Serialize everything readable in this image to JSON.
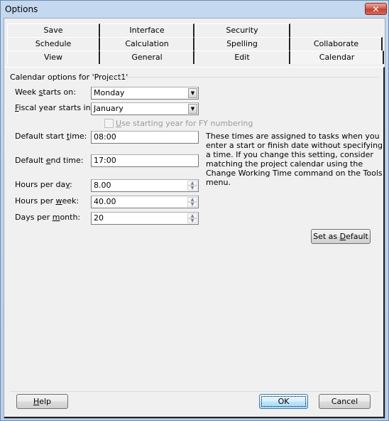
{
  "window": {
    "title": "Options",
    "close_icon": "close-x-icon"
  },
  "tabs": {
    "row1": [
      "Save",
      "Interface",
      "Security"
    ],
    "row2": [
      "Schedule",
      "Calculation",
      "Spelling",
      "Collaborate"
    ],
    "row3": [
      "View",
      "General",
      "Edit",
      "Calendar"
    ],
    "active": "Calendar"
  },
  "calendar": {
    "group_label": "Calendar options for 'Project1'",
    "week_starts_on": {
      "label_pre": "Week ",
      "label_u": "s",
      "label_post": "tarts on:",
      "value": "Monday"
    },
    "fiscal_year": {
      "label_pre": "",
      "label_u": "F",
      "label_post": "iscal year starts in:",
      "value": "January"
    },
    "fy_checkbox": {
      "label_pre": "",
      "label_u": "U",
      "label_post": "se starting year for FY numbering",
      "checked": false,
      "enabled": false
    },
    "default_start": {
      "label_pre": "Default start ",
      "label_u": "t",
      "label_post": "ime:",
      "value": "08:00"
    },
    "default_end": {
      "label_pre": "Default ",
      "label_u": "e",
      "label_post": "nd time:",
      "value": "17:00"
    },
    "description": "These times are assigned to tasks when you enter a start or finish date without specifying a time. If you change this setting, consider matching the project calendar using the Change Working Time command on the Tools menu.",
    "hours_per_day": {
      "label_pre": "Hours per da",
      "label_u": "y",
      "label_post": ":",
      "value": "8.00"
    },
    "hours_per_week": {
      "label_pre": "Hours per ",
      "label_u": "w",
      "label_post": "eek:",
      "value": "40.00"
    },
    "days_per_month": {
      "label_pre": "Days per ",
      "label_u": "m",
      "label_post": "onth:",
      "value": "20"
    },
    "set_default": {
      "pre": "Set as ",
      "u": "D",
      "post": "efault"
    }
  },
  "footer": {
    "help": {
      "u": "H",
      "post": "elp"
    },
    "ok": "OK",
    "cancel": "Cancel"
  }
}
